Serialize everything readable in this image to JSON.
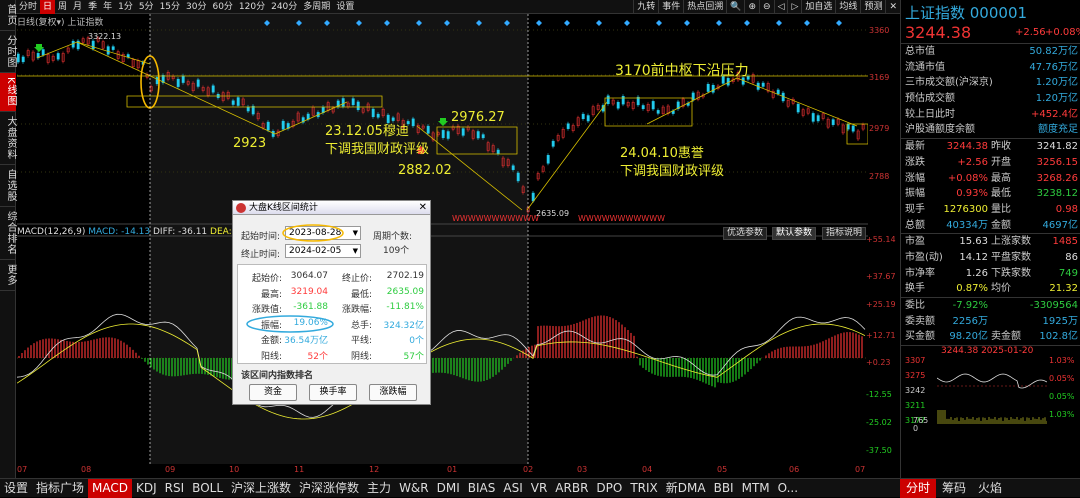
{
  "top_tabs": [
    "分时",
    "日",
    "周",
    "月",
    "季",
    "年",
    "1分",
    "5分",
    "15分",
    "30分",
    "60分",
    "120分",
    "240分",
    "多周期",
    "设置"
  ],
  "top_tabs_active": 1,
  "top_right_tabs": [
    "九转",
    "事件",
    "热点回溯",
    "🔍",
    "⊕",
    "⊖",
    "◁",
    "▷",
    "加自选",
    "均线",
    "预测",
    "✕"
  ],
  "left_nav": [
    "首页",
    "分时图",
    "K线图",
    "大盘资料",
    "自选股",
    "综合排名",
    "更多"
  ],
  "left_nav_active": 2,
  "chart_title": "日线(复权▾)  上证指数",
  "macd_label": {
    "name": "MACD(12,26,9)",
    "macd": "MACD: -14.13",
    "diff": "DIFF: -36.11",
    "dea": "DEA: -29.04"
  },
  "price_axis": [
    "3360",
    "3169",
    "2979",
    "2788"
  ],
  "macd_axis": [
    "+55.14",
    "+37.67",
    "+25.19",
    "+12.71",
    "+0.23",
    "-12.55",
    "-25.02",
    "-37.50"
  ],
  "x_axis": [
    "07",
    "08",
    "09",
    "10",
    "11",
    "12",
    "01",
    "02",
    "03",
    "04",
    "05",
    "06",
    "07"
  ],
  "macd_buttons": [
    "优选参数",
    "默认参数",
    "指标说明"
  ],
  "macd_buttons_active": 1,
  "price_labels": {
    "high": "3322.13",
    "low": "2635.09"
  },
  "annotations": {
    "a1": "3170前中枢下沿压力",
    "a2": "2923",
    "a3": "23.12.05穆迪",
    "a4": "下调我国财政评级",
    "a5": "2976.27",
    "a6": "2882.02",
    "a7": "24.04.10惠誉",
    "a8": "下调我国财政评级",
    "w_marks": "WWWWWWWWWWW"
  },
  "dialog": {
    "title": "大盘K线区间统计",
    "start_label": "起始时间:",
    "start_value": "2023-08-28",
    "end_label": "终止时间:",
    "end_value": "2024-02-05",
    "period_label": "周期个数:",
    "period_value": "109个",
    "stats": [
      {
        "k1": "起始价:",
        "v1": "3064.07",
        "c1": "white",
        "k2": "终止价:",
        "v2": "2702.19",
        "c2": "white"
      },
      {
        "k1": "最高:",
        "v1": "3219.04",
        "c1": "red",
        "k2": "最低:",
        "v2": "2635.09",
        "c2": "green"
      },
      {
        "k1": "涨跌值:",
        "v1": "-361.88",
        "c1": "green",
        "k2": "涨跌幅:",
        "v2": "-11.81%",
        "c2": "green"
      },
      {
        "k1": "振幅:",
        "v1": "19.06%",
        "c1": "cyan",
        "k2": "总手:",
        "v2": "324.32亿",
        "c2": "cyan"
      },
      {
        "k1": "金额:",
        "v1": "36.54万亿",
        "c1": "cyan",
        "k2": "平线:",
        "v2": "0个",
        "c2": "cyan"
      },
      {
        "k1": "阳线:",
        "v1": "52个",
        "c1": "red",
        "k2": "阴线:",
        "v2": "57个",
        "c2": "green"
      }
    ],
    "rank_label": "该区间内指数排名",
    "buttons": [
      "资金",
      "换手率",
      "涨跌幅"
    ]
  },
  "right": {
    "name": "上证指数 000001",
    "price": "3244.38",
    "change": "+2.56",
    "pct": "+0.08%",
    "rows1": [
      {
        "l": "总市值",
        "r": "50.82万亿",
        "rc": "cyan"
      },
      {
        "l": "流通市值",
        "r": "47.76万亿",
        "rc": "cyan"
      },
      {
        "l": "三市成交额(沪深京)",
        "r": "1.20万亿",
        "rc": "cyan"
      },
      {
        "l": "预估成交额",
        "r": "1.20万亿",
        "rc": "cyan"
      },
      {
        "l": "较上日此时",
        "r": "+452.4亿",
        "rc": "red"
      },
      {
        "l": "沪股通额度余额",
        "r": "额度充足",
        "rc": "cyan"
      }
    ],
    "rows2": [
      {
        "l": "最新",
        "m": "3244.38",
        "mc": "red",
        "l2": "昨收",
        "r": "3241.82",
        "rc": "white"
      },
      {
        "l": "涨跌",
        "m": "+2.56",
        "mc": "red",
        "l2": "开盘",
        "r": "3256.15",
        "rc": "red"
      },
      {
        "l": "涨幅",
        "m": "+0.08%",
        "mc": "red",
        "l2": "最高",
        "r": "3268.26",
        "rc": "red"
      },
      {
        "l": "振幅",
        "m": "0.93%",
        "mc": "red",
        "l2": "最低",
        "r": "3238.12",
        "rc": "green"
      },
      {
        "l": "现手",
        "m": "1276300",
        "mc": "yellow",
        "l2": "量比",
        "r": "0.98",
        "rc": "red"
      },
      {
        "l": "总额",
        "m": "40334万",
        "mc": "cyan",
        "l2": "金额",
        "r": "4697亿",
        "rc": "cyan"
      }
    ],
    "rows3": [
      {
        "l": "市盈",
        "m": "15.63",
        "mc": "white",
        "l2": "上涨家数",
        "r": "1485",
        "rc": "red"
      },
      {
        "l": "市盈(动)",
        "m": "14.12",
        "mc": "white",
        "l2": "平盘家数",
        "r": "86",
        "rc": "white"
      },
      {
        "l": "市净率",
        "m": "1.26",
        "mc": "white",
        "l2": "下跌家数",
        "r": "749",
        "rc": "green"
      },
      {
        "l": "换手",
        "m": "0.87%",
        "mc": "yellow",
        "l2": "均价",
        "r": "21.32",
        "rc": "yellow"
      }
    ],
    "rows4": [
      {
        "l": "委比",
        "m": "-7.92%",
        "mc": "green",
        "l2": "",
        "r": "-3309564",
        "rc": "green"
      },
      {
        "l": "委卖额",
        "m": "2256万",
        "mc": "cyan",
        "l2": "",
        "r": "1925万",
        "rc": "cyan"
      },
      {
        "l": "买金额",
        "m": "98.20亿",
        "mc": "cyan",
        "l2": "卖金额",
        "r": "102.8亿",
        "rc": "cyan"
      }
    ],
    "mini_axis_left": [
      "3307",
      "3275",
      "3242",
      "3211",
      "3177"
    ],
    "mini_axis_right": [
      "1.03%",
      "0.05%",
      "0.05%",
      "1.03%"
    ],
    "mini_bottom": [
      "765",
      "0"
    ],
    "mini_top": "3244.38    2025-01-20"
  },
  "bottom_tabs": [
    "设置",
    "指标广场",
    "MACD",
    "KDJ",
    "RSI",
    "BOLL",
    "沪深上涨数",
    "沪深涨停数",
    "主力",
    "W&R",
    "DMI",
    "BIAS",
    "ASI",
    "VR",
    "ARBR",
    "DPO",
    "TRIX",
    "新DMA",
    "BBI",
    "MTM",
    "O..."
  ],
  "bottom_tabs_active": 2,
  "bottom_right_tabs": [
    "分时",
    "筹码",
    "火焰"
  ],
  "bottom_right_active": 0
}
